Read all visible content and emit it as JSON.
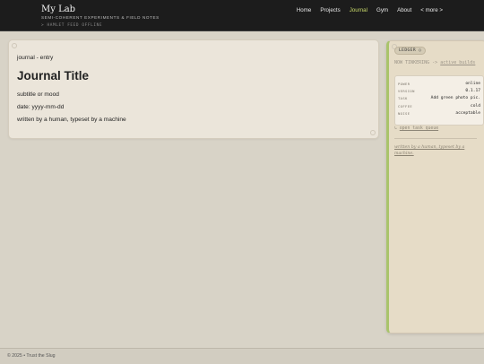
{
  "header": {
    "title": "My Lab",
    "subtitle": "SEMI-COHERENT EXPERIMENTS & FIELD NOTES",
    "status": "> HAMLET FEED OFFLINE",
    "nav": [
      {
        "label": "Home"
      },
      {
        "label": "Projects"
      },
      {
        "label": "Journal",
        "active": true
      },
      {
        "label": "Gym"
      },
      {
        "label": "About"
      },
      {
        "label": "< more >"
      }
    ]
  },
  "entry": {
    "kicker": "journal - entry",
    "title": "Journal Title",
    "subtitle": "subtitle or mood",
    "date": "date: yyyy-mm-dd",
    "credit": "written by a human, typeset by a machine"
  },
  "sidebar": {
    "badge": "LEDGER ○",
    "now_prefix": "NOW TINKERING ->",
    "now_link": "active builds",
    "stats": [
      {
        "key": "POWER",
        "value": "online"
      },
      {
        "key": "VERSION",
        "value": "0.1.17"
      },
      {
        "key": "TASK",
        "value": "Add green photo pic."
      },
      {
        "key": "COFFEE",
        "value": "cold"
      },
      {
        "key": "NOISE",
        "value": "acceptable"
      }
    ],
    "queue_icon": "↳",
    "queue_label": "open task queue",
    "credit": "written by a human, typeset by a machine."
  },
  "footer": {
    "text": "© 2025 • Trust the Slug"
  },
  "colors": {
    "accent": "#a9c46b",
    "nav_active": "#c8d96a"
  }
}
